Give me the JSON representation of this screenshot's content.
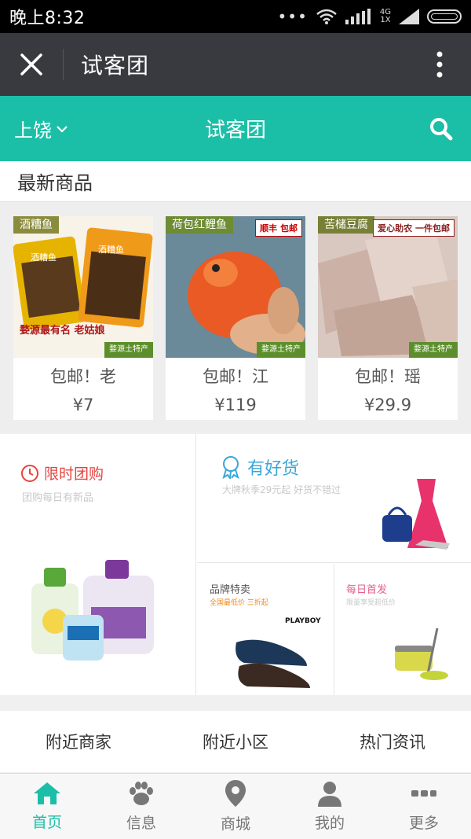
{
  "status": {
    "time": "晚上8:32",
    "network_top": "4G",
    "network_bottom": "1X"
  },
  "titlebar": {
    "title": "试客团"
  },
  "header": {
    "city": "上饶",
    "title": "试客团"
  },
  "section": {
    "title": "最新商品"
  },
  "products": [
    {
      "name": "包邮！老",
      "price": "¥7",
      "tag": "酒糟鱼",
      "corner": "婺源土特产",
      "caption": "婺源最有名 老姑娘",
      "badge": ""
    },
    {
      "name": "包邮！江",
      "price": "¥119",
      "tag": "荷包红鲤鱼",
      "corner": "婺源土特产",
      "caption": "",
      "badge": "顺丰 包邮"
    },
    {
      "name": "包邮！瑶",
      "price": "¥29.9",
      "tag": "苦槠豆腐",
      "corner": "婺源土特产",
      "caption": "",
      "badge": "爱心助农 一件包邮"
    }
  ],
  "promos": {
    "flash": {
      "title": "限时团购",
      "subtitle": "团购每日有新品"
    },
    "goods": {
      "title": "有好货",
      "subtitle": "大牌秋季29元起 好货不错过"
    },
    "brand": {
      "title": "品牌特卖",
      "subtitle": "全国最低价 三折起",
      "logo": "PLAYBOY"
    },
    "daily": {
      "title": "每日首发",
      "subtitle": "限量享受超低价"
    }
  },
  "links": [
    "附近商家",
    "附近小区",
    "热门资讯"
  ],
  "tabs": [
    {
      "label": "首页",
      "icon": "home-icon",
      "active": true
    },
    {
      "label": "信息",
      "icon": "paw-icon",
      "active": false
    },
    {
      "label": "商城",
      "icon": "location-pin-icon",
      "active": false
    },
    {
      "label": "我的",
      "icon": "user-icon",
      "active": false
    },
    {
      "label": "更多",
      "icon": "more-dots-icon",
      "active": false
    }
  ],
  "colors": {
    "teal": "#1bbfa7",
    "dark_bar": "#393a3f",
    "promo_red": "#e6433e",
    "promo_blue": "#3aa7d8"
  }
}
